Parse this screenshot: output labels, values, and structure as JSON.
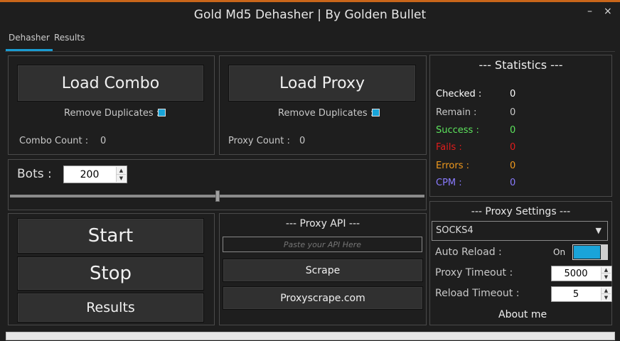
{
  "window": {
    "title": "Gold Md5 Dehasher | By Golden Bullet",
    "minimize": "–",
    "close": "×"
  },
  "tabs": [
    {
      "label": "Dehasher"
    },
    {
      "label": "Results"
    }
  ],
  "combo": {
    "button": "Load Combo",
    "remove_duplicates": "Remove Duplicates :",
    "count_label": "Combo Count :",
    "count_value": "0"
  },
  "proxy": {
    "button": "Load Proxy",
    "remove_duplicates": "Remove Duplicates :",
    "count_label": "Proxy Count :",
    "count_value": "0"
  },
  "bots": {
    "label": "Bots :",
    "value": "200"
  },
  "actions": {
    "start": "Start",
    "stop": "Stop",
    "results": "Results"
  },
  "proxy_api": {
    "title": "--- Proxy API ---",
    "placeholder": "Paste your API Here",
    "scrape": "Scrape",
    "proxyscrape": "Proxyscrape.com"
  },
  "statistics": {
    "title": "--- Statistics ---",
    "rows": [
      {
        "label": "Checked :",
        "value": "0",
        "color": "#ffffff"
      },
      {
        "label": "Remain :",
        "value": "0",
        "color": "#c8c8c8"
      },
      {
        "label": "Success :",
        "value": "0",
        "color": "#5de35d"
      },
      {
        "label": "Fails :",
        "value": "0",
        "color": "#e01c1c"
      },
      {
        "label": "Errors :",
        "value": "0",
        "color": "#f19a1d"
      },
      {
        "label": "CPM :",
        "value": "0",
        "color": "#8a7bff"
      }
    ]
  },
  "proxy_settings": {
    "title": "--- Proxy Settings ---",
    "type": "SOCKS4",
    "auto_reload_label": "Auto Reload :",
    "auto_reload_state": "On",
    "timeout_label": "Proxy Timeout :",
    "timeout_value": "5000",
    "reload_timeout_label": "Reload Timeout :",
    "reload_timeout_value": "5",
    "about": "About me"
  }
}
